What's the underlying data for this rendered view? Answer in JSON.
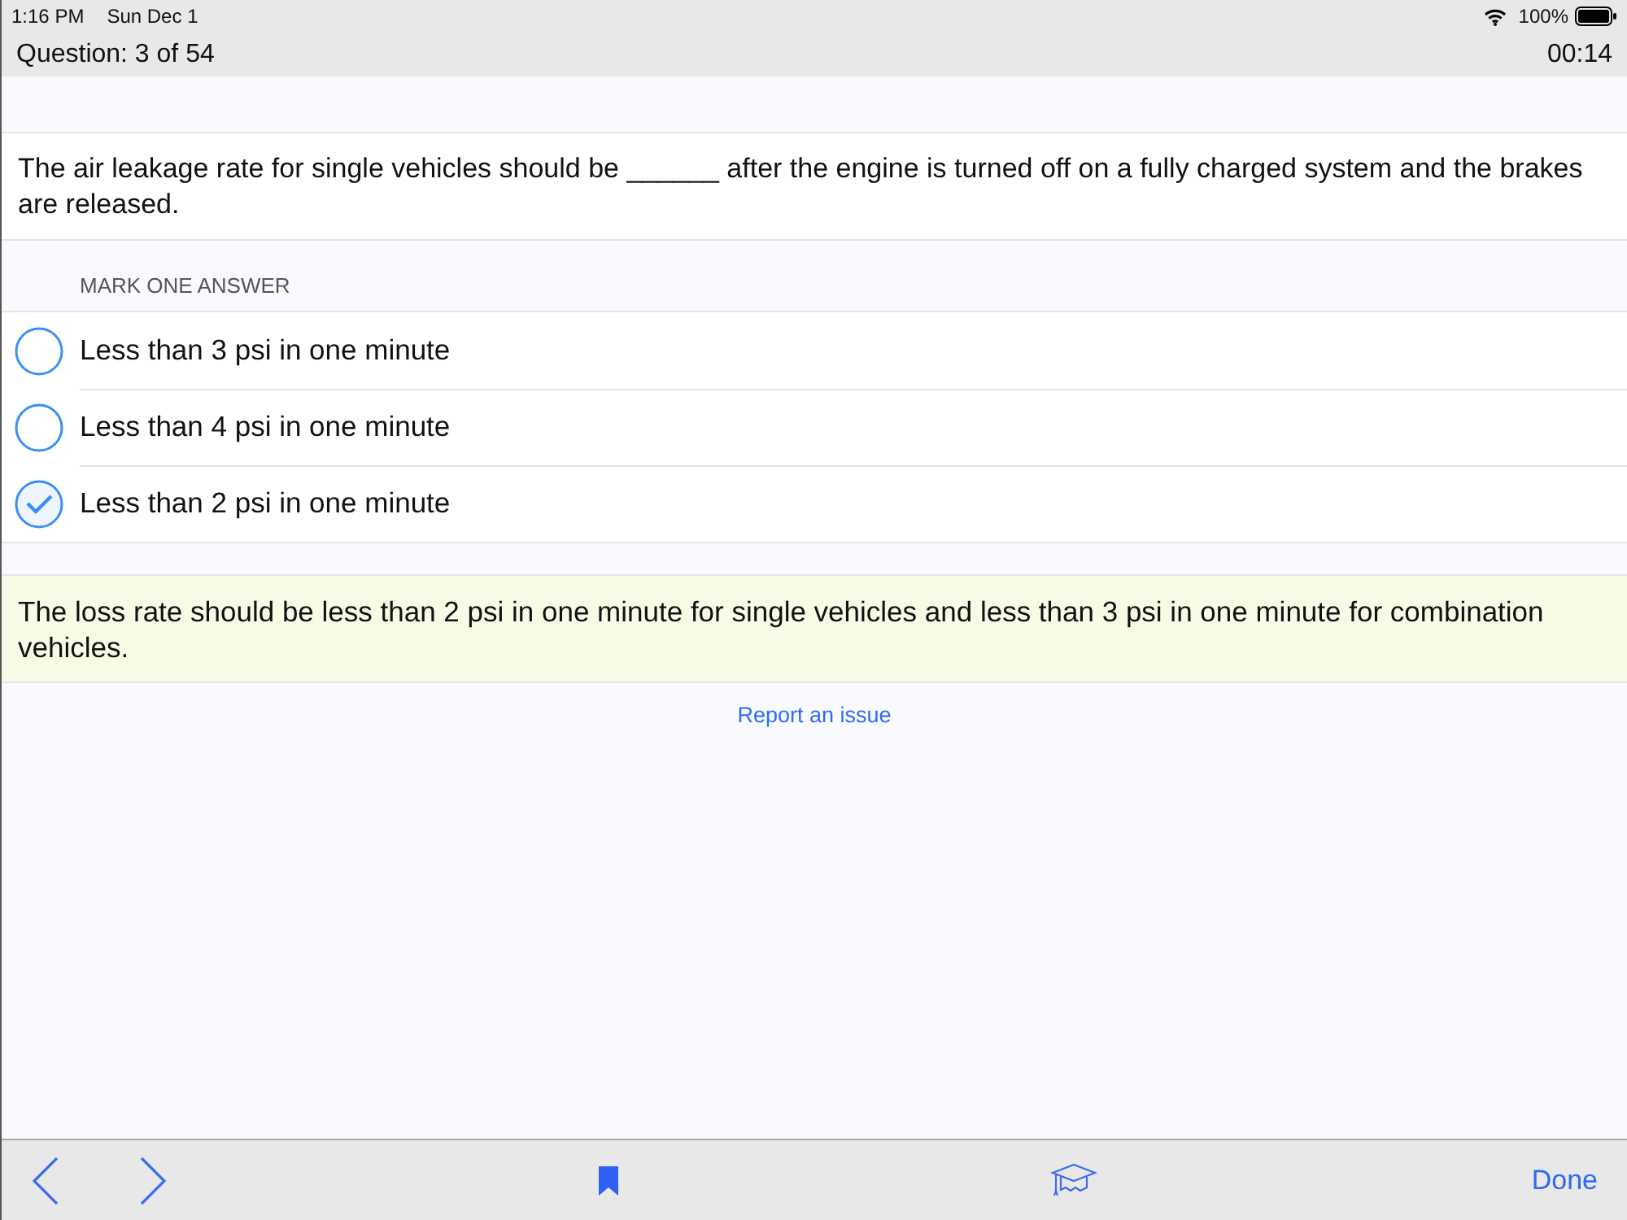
{
  "status_bar": {
    "time": "1:16 PM",
    "date": "Sun Dec 1",
    "battery": "100%"
  },
  "header": {
    "question": "Question: 3 of 54",
    "timer": "00:14"
  },
  "question": "The air leakage rate for single vehicles should be ______ after the engine is turned off on a fully charged system and the brakes are released.",
  "answers_header": "MARK ONE ANSWER",
  "answers": [
    {
      "label": "Less than 3 psi in one minute",
      "selected": false
    },
    {
      "label": "Less than 4 psi in one minute",
      "selected": false
    },
    {
      "label": "Less than 2 psi in one minute",
      "selected": true
    }
  ],
  "explanation": "The loss rate should be less than 2 psi in one minute for single vehicles and less than 3 psi in one minute for combination vehicles.",
  "report_link": "Report an issue",
  "toolbar": {
    "done": "Done"
  }
}
